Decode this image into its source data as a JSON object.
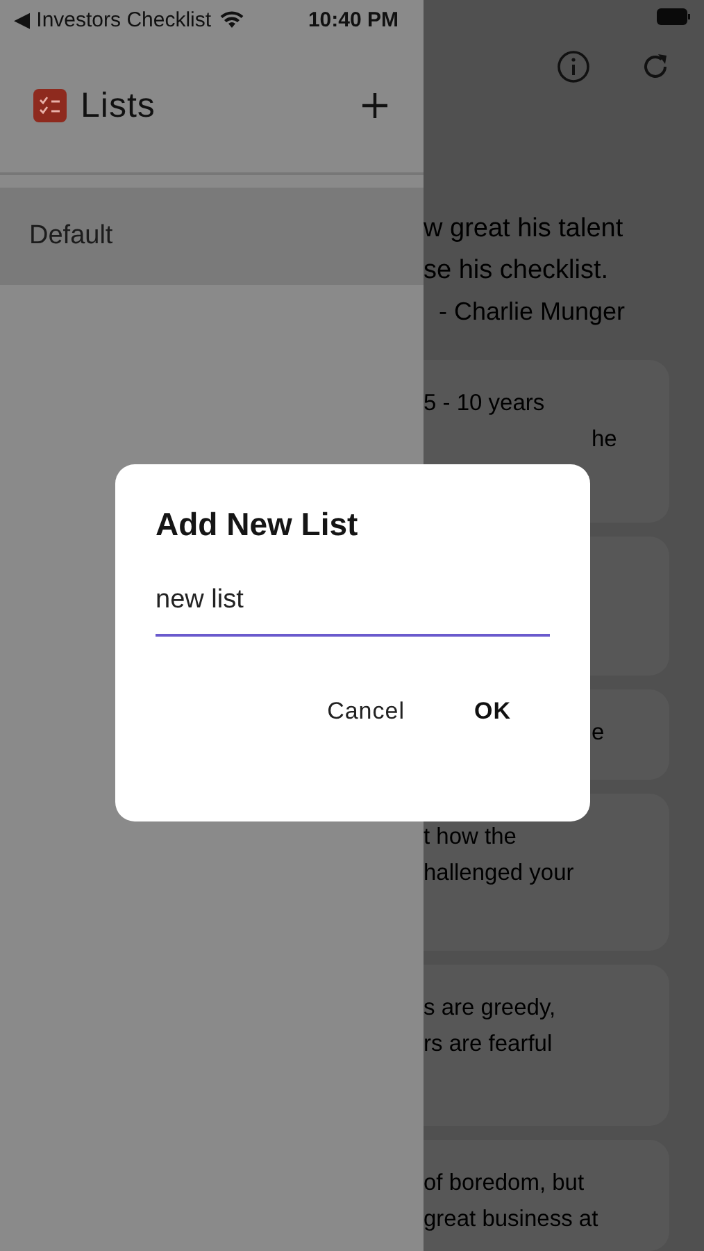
{
  "status_bar": {
    "back_label": "◀ Investors Checklist",
    "time": "10:40 PM"
  },
  "drawer": {
    "title": "Lists",
    "items": [
      {
        "label": "Default",
        "selected": true
      }
    ]
  },
  "main": {
    "quote_lines": [
      "w great his talent",
      "se his checklist."
    ],
    "quote_author": "- Charlie Munger",
    "cards": [
      {
        "lines": [
          {
            "text": "5 - 10 years",
            "kind": "full"
          },
          {
            "text": "he",
            "kind": "tail"
          }
        ]
      },
      {
        "lines": [
          {
            "text": "e",
            "kind": "tail"
          }
        ]
      },
      {
        "lines": [
          {
            "text": "t how the",
            "kind": "full"
          },
          {
            "text": "hallenged your",
            "kind": "full"
          }
        ]
      },
      {
        "lines": [
          {
            "text": "s are greedy,",
            "kind": "full"
          },
          {
            "text": "rs are fearful",
            "kind": "full"
          }
        ]
      },
      {
        "lines": [
          {
            "text": "of boredom, but",
            "kind": "full"
          },
          {
            "text": "great business at",
            "kind": "full"
          }
        ]
      }
    ]
  },
  "dialog": {
    "title": "Add New List",
    "value": "new list",
    "buttons": [
      {
        "label": "Cancel",
        "kind": "secondary"
      },
      {
        "label": "OK",
        "kind": "primary"
      }
    ]
  }
}
